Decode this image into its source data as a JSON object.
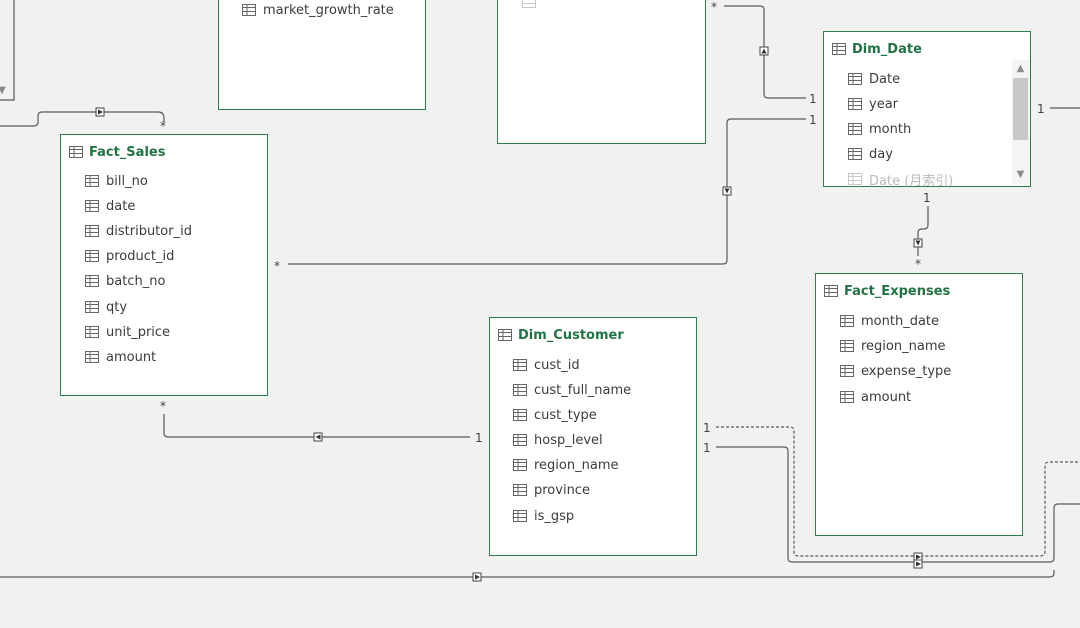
{
  "diagram": {
    "partial_tables": {
      "market_table": {
        "fields": [
          "market_growth_rate"
        ]
      }
    },
    "tables": {
      "fact_sales": {
        "title": "Fact_Sales",
        "fields": [
          "bill_no",
          "date",
          "distributor_id",
          "product_id",
          "batch_no",
          "qty",
          "unit_price",
          "amount"
        ]
      },
      "dim_date": {
        "title": "Dim_Date",
        "fields": [
          "Date",
          "year",
          "month",
          "day",
          "Date (月索引)"
        ]
      },
      "fact_expenses": {
        "title": "Fact_Expenses",
        "fields": [
          "month_date",
          "region_name",
          "expense_type",
          "amount"
        ]
      },
      "dim_customer": {
        "title": "Dim_Customer",
        "fields": [
          "cust_id",
          "cust_full_name",
          "cust_type",
          "hosp_level",
          "region_name",
          "province",
          "is_gsp"
        ]
      }
    },
    "cardinality": {
      "one": "1",
      "many": "*"
    },
    "scroll": {
      "up": "▲",
      "down": "▼"
    }
  }
}
